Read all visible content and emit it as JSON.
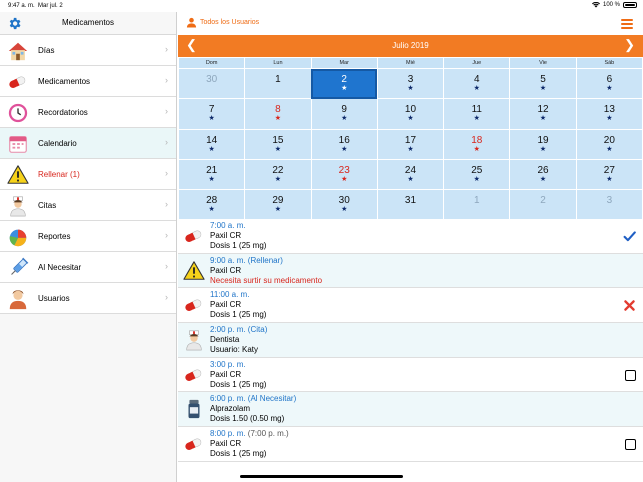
{
  "status_bar": {
    "time": "9:47 a. m.",
    "date": "Mar jul. 2",
    "battery": "100 %"
  },
  "sidebar": {
    "title": "Medicamentos",
    "items": [
      {
        "label": "Días",
        "icon": "house-icon",
        "warn": false
      },
      {
        "label": "Medicamentos",
        "icon": "pill-icon",
        "warn": false
      },
      {
        "label": "Recordatorios",
        "icon": "clock-icon",
        "warn": false
      },
      {
        "label": "Calendario",
        "icon": "calendar-icon",
        "warn": false
      },
      {
        "label": "Rellenar (1)",
        "icon": "warning-icon",
        "warn": true
      },
      {
        "label": "Citas",
        "icon": "nurse-icon",
        "warn": false
      },
      {
        "label": "Reportes",
        "icon": "pie-chart-icon",
        "warn": false
      },
      {
        "label": "Al Necesitar",
        "icon": "syringe-icon",
        "warn": false
      },
      {
        "label": "Usuarios",
        "icon": "user-icon",
        "warn": false
      }
    ]
  },
  "header": {
    "users_label": "Todos los Usuarios"
  },
  "calendar": {
    "month_title": "Julio 2019",
    "weekdays": [
      "Dom",
      "Lun",
      "Mar",
      "Mié",
      "Jue",
      "Vie",
      "Sáb"
    ],
    "weeks": [
      [
        {
          "d": "30",
          "grey": true,
          "star": ""
        },
        {
          "d": "1",
          "star": ""
        },
        {
          "d": "2",
          "star": "white",
          "today": true
        },
        {
          "d": "3",
          "star": "blue"
        },
        {
          "d": "4",
          "star": "blue"
        },
        {
          "d": "5",
          "star": "blue"
        },
        {
          "d": "6",
          "star": "blue"
        }
      ],
      [
        {
          "d": "7",
          "star": "blue"
        },
        {
          "d": "8",
          "red": true,
          "star": "red"
        },
        {
          "d": "9",
          "star": "blue"
        },
        {
          "d": "10",
          "star": "blue"
        },
        {
          "d": "11",
          "star": "blue"
        },
        {
          "d": "12",
          "star": "blue"
        },
        {
          "d": "13",
          "star": "blue"
        }
      ],
      [
        {
          "d": "14",
          "star": "blue"
        },
        {
          "d": "15",
          "star": "blue"
        },
        {
          "d": "16",
          "star": "blue"
        },
        {
          "d": "17",
          "star": "blue"
        },
        {
          "d": "18",
          "red": true,
          "star": "red"
        },
        {
          "d": "19",
          "star": "blue"
        },
        {
          "d": "20",
          "star": "blue"
        }
      ],
      [
        {
          "d": "21",
          "star": "blue"
        },
        {
          "d": "22",
          "star": "blue"
        },
        {
          "d": "23",
          "red": true,
          "star": "red"
        },
        {
          "d": "24",
          "star": "blue"
        },
        {
          "d": "25",
          "star": "blue"
        },
        {
          "d": "26",
          "star": "blue"
        },
        {
          "d": "27",
          "star": "blue"
        }
      ],
      [
        {
          "d": "28",
          "star": "blue"
        },
        {
          "d": "29",
          "star": "blue"
        },
        {
          "d": "30",
          "star": "blue"
        },
        {
          "d": "31",
          "star": ""
        },
        {
          "d": "1",
          "grey": true,
          "star": ""
        },
        {
          "d": "2",
          "grey": true,
          "star": ""
        },
        {
          "d": "3",
          "grey": true,
          "star": ""
        }
      ]
    ]
  },
  "events": [
    {
      "time": "7:00 a. m.",
      "paren": "",
      "line2": "Paxil CR",
      "line3": "Dosis 1 (25 mg)",
      "line3_warn": false,
      "icon": "pill-icon",
      "status": "check"
    },
    {
      "time": "9:00 a. m. (Rellenar)",
      "paren": "",
      "line2": "Paxil CR",
      "line3": "Necesita surtir su medicamento",
      "line3_warn": true,
      "icon": "warning-icon",
      "status": ""
    },
    {
      "time": "11:00 a. m.",
      "paren": "",
      "line2": "Paxil CR",
      "line3": "Dosis 1 (25 mg)",
      "line3_warn": false,
      "icon": "pill-icon",
      "status": "cross"
    },
    {
      "time": "2:00 p. m. (Cita)",
      "paren": "",
      "line2": "Dentista",
      "line3": "Usuario: Katy",
      "line3_warn": false,
      "icon": "nurse-icon",
      "status": ""
    },
    {
      "time": "3:00 p. m.",
      "paren": "",
      "line2": "Paxil CR",
      "line3": "Dosis 1 (25 mg)",
      "line3_warn": false,
      "icon": "pill-icon",
      "status": "box"
    },
    {
      "time": "6:00 p. m. (Al Necesitar)",
      "paren": "",
      "line2": "Alprazolam",
      "line3": "Dosis 1.50 (0.50 mg)",
      "line3_warn": false,
      "icon": "bottle-icon",
      "status": ""
    },
    {
      "time": "8:00 p. m.",
      "paren": " (7:00 p. m.)",
      "line2": "Paxil CR",
      "line3": "Dosis 1 (25 mg)",
      "line3_warn": false,
      "icon": "pill-icon",
      "status": "box"
    }
  ],
  "colors": {
    "accent": "#f27b23",
    "calendar_cell": "#cbe4f7",
    "today": "#1f75cf",
    "link": "#1f74c8",
    "alert": "#d8261d"
  }
}
